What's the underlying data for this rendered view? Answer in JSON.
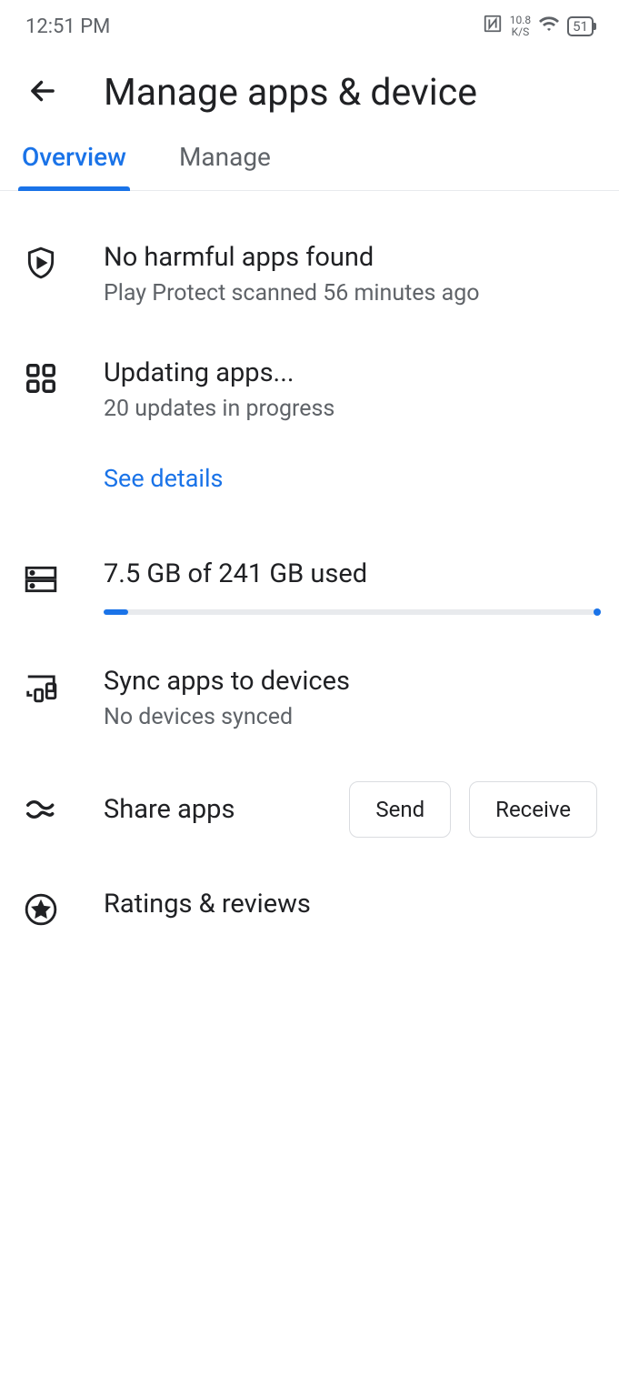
{
  "statusBar": {
    "time": "12:51 PM",
    "speed1": "10.8",
    "speed2": "K/S",
    "battery": "51"
  },
  "header": {
    "title": "Manage apps & device"
  },
  "tabs": {
    "overview": "Overview",
    "manage": "Manage"
  },
  "protect": {
    "title": "No harmful apps found",
    "sub": "Play Protect scanned 56 minutes ago"
  },
  "updates": {
    "title": "Updating apps...",
    "sub": "20 updates in progress",
    "link": "See details"
  },
  "storage": {
    "text": "7.5 GB of 241 GB used"
  },
  "sync": {
    "title": "Sync apps to devices",
    "sub": "No devices synced"
  },
  "share": {
    "label": "Share apps",
    "send": "Send",
    "receive": "Receive"
  },
  "ratings": {
    "title": "Ratings & reviews"
  }
}
